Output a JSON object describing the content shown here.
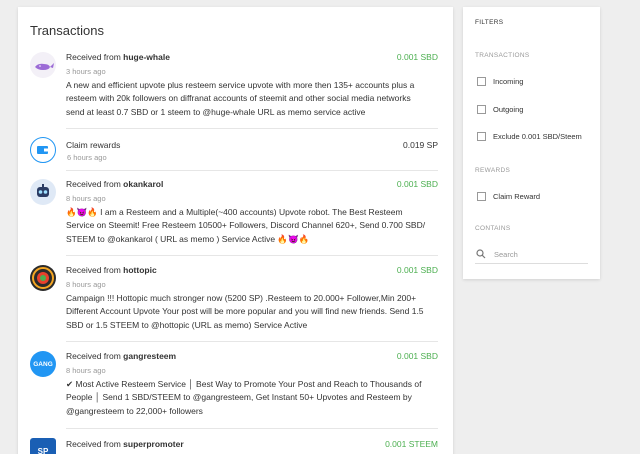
{
  "page_title": "Transactions",
  "transactions": [
    {
      "prefix": "Received from ",
      "user": "huge-whale",
      "time": "3 hours ago",
      "amount": "0.001 SBD",
      "memo": "A new and efficient upvote plus resteem service upvote with more then 135+ accounts plus a resteem with 20k followers on diffranat accounts of steemit and other social media networks send at least 0.7 SBD or 1 steem to @huge-whale URL as memo service active",
      "avatar_icon": "whale-icon"
    },
    {
      "prefix": "",
      "user": "Claim rewards",
      "time": "6 hours ago",
      "amount": "0.019 SP",
      "memo": "",
      "avatar_icon": "wallet-icon"
    },
    {
      "prefix": "Received from ",
      "user": "okankarol",
      "time": "8 hours ago",
      "amount": "0.001 SBD",
      "memo": "🔥😈🔥 I am a Resteem and a Multiple(~400 accounts) Upvote robot. The Best Resteem Service on Steemit! Free Resteem 10500+ Followers, Discord Channel 620+, Send 0.700 SBD/ STEEM to @okankarol ( URL as memo ) Service Active 🔥😈🔥",
      "avatar_icon": "robot-icon"
    },
    {
      "prefix": "Received from ",
      "user": "hottopic",
      "time": "8 hours ago",
      "amount": "0.001 SBD",
      "memo": "Campaign !!! Hottopic much stronger now (5200 SP) .Resteem to 20.000+ Follower,Min 200+ Different Account Upvote Your post will be more popular and you will find new friends. Send 1.5 SBD or 1.5 STEEM to @hottopic (URL as memo) Service Active",
      "avatar_icon": "hottopic-icon"
    },
    {
      "prefix": "Received from ",
      "user": "gangresteem",
      "time": "8 hours ago",
      "amount": "0.001 SBD",
      "memo": "✔ Most Active Resteem Service │ Best Way to Promote Your Post and Reach to Thousands of People │ Send 1 SBD/STEEM to @gangresteem, Get Instant 50+ Upvotes and Resteem by @gangresteem to 22,000+ followers",
      "avatar_icon": "gang-icon"
    },
    {
      "prefix": "Received from ",
      "user": "superpromoter",
      "time": "",
      "amount": "0.001 STEEM",
      "memo": "",
      "avatar_icon": "sp-icon"
    }
  ],
  "avatars": {
    "gang_text": "GANG",
    "sp_text": "SP"
  },
  "filters": {
    "title": "FILTERS",
    "transactions_heading": "TRANSACTIONS",
    "incoming": "Incoming",
    "outgoing": "Outgoing",
    "exclude": "Exclude 0.001 SBD/Steem",
    "rewards_heading": "REWARDS",
    "claim_reward": "Claim Reward",
    "contains_heading": "CONTAINS",
    "search_placeholder": "Search"
  },
  "colors": {
    "amount_green": "#4caf50",
    "background": "#eeeeee",
    "avatar_blue": "#2196f3"
  }
}
